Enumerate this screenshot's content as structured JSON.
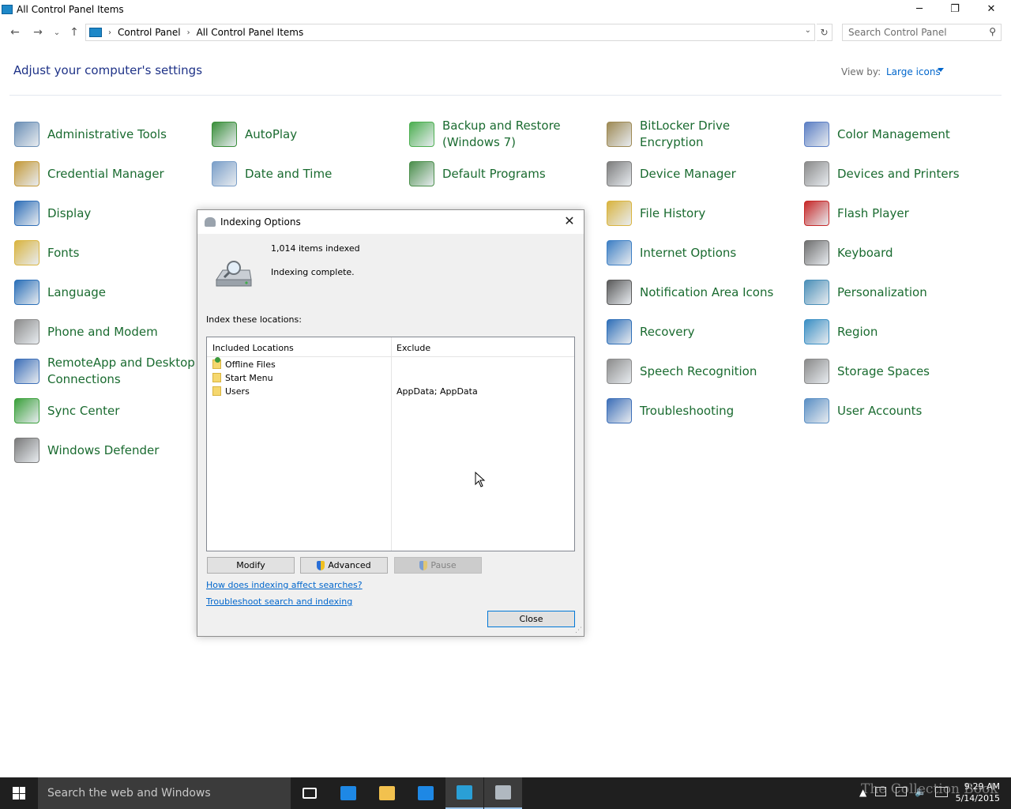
{
  "window": {
    "title": "All Control Panel Items",
    "minimize_glyph": "─",
    "restore_glyph": "❐",
    "close_glyph": "✕"
  },
  "nav": {
    "back_glyph": "←",
    "forward_glyph": "→",
    "recent_glyph": "⌄",
    "up_glyph": "↑",
    "breadcrumbs": [
      "Control Panel",
      "All Control Panel Items"
    ],
    "separator": "›",
    "dropdown_glyph": "⌄",
    "refresh_glyph": "↻",
    "search_placeholder": "Search Control Panel",
    "search_glyph": "⚲"
  },
  "header": {
    "title": "Adjust your computer's settings",
    "view_by_label": "View by:",
    "view_by_value": "Large icons"
  },
  "items": [
    {
      "label": "Administrative Tools",
      "icon": "admin-tools-icon",
      "color": "#6b8fb5"
    },
    {
      "label": "AutoPlay",
      "icon": "autoplay-icon",
      "color": "#3a8f3a"
    },
    {
      "label": "Backup and Restore (Windows 7)",
      "icon": "backup-icon",
      "color": "#4caf50"
    },
    {
      "label": "BitLocker Drive Encryption",
      "icon": "bitlocker-icon",
      "color": "#9e8a55"
    },
    {
      "label": "Color Management",
      "icon": "color-management-icon",
      "color": "#5c7fc4"
    },
    {
      "label": "Credential Manager",
      "icon": "credential-icon",
      "color": "#c49a3a"
    },
    {
      "label": "Date and Time",
      "icon": "clock-icon",
      "color": "#7a9ec8"
    },
    {
      "label": "Default Programs",
      "icon": "default-programs-icon",
      "color": "#4b8f4b"
    },
    {
      "label": "Device Manager",
      "icon": "device-manager-icon",
      "color": "#7d7d7d"
    },
    {
      "label": "Devices and Printers",
      "icon": "printer-icon",
      "color": "#8a8a8a"
    },
    {
      "label": "Display",
      "icon": "display-icon",
      "color": "#2f6fb8"
    },
    {
      "label": "File History",
      "icon": "file-history-icon",
      "color": "#d9b440"
    },
    {
      "label": "Flash Player",
      "icon": "flash-icon",
      "color": "#c62828"
    },
    {
      "label": "Fonts",
      "icon": "fonts-icon",
      "color": "#d9b440"
    },
    {
      "label": "Internet Options",
      "icon": "internet-icon",
      "color": "#3d7fc4"
    },
    {
      "label": "Keyboard",
      "icon": "keyboard-icon",
      "color": "#6f6f6f"
    },
    {
      "label": "Language",
      "icon": "language-icon",
      "color": "#2a6fb8"
    },
    {
      "label": "Notification Area Icons",
      "icon": "notification-icon",
      "color": "#5a5a5a"
    },
    {
      "label": "Personalization",
      "icon": "personalization-icon",
      "color": "#4a8fb8"
    },
    {
      "label": "Phone and Modem",
      "icon": "phone-icon",
      "color": "#8c8c8c"
    },
    {
      "label": "Recovery",
      "icon": "recovery-icon",
      "color": "#2f6fb8"
    },
    {
      "label": "Region",
      "icon": "region-icon",
      "color": "#3a8fc4"
    },
    {
      "label": "RemoteApp and Desktop Connections",
      "icon": "remoteapp-icon",
      "color": "#3d6fb8"
    },
    {
      "label": "Speech Recognition",
      "icon": "microphone-icon",
      "color": "#8c8c8c"
    },
    {
      "label": "Storage Spaces",
      "icon": "storage-icon",
      "color": "#8a8a8a"
    },
    {
      "label": "Sync Center",
      "icon": "sync-icon",
      "color": "#3aa03a"
    },
    {
      "label": "Troubleshooting",
      "icon": "troubleshooting-icon",
      "color": "#3d6fb8"
    },
    {
      "label": "User Accounts",
      "icon": "user-accounts-icon",
      "color": "#5a8fc4"
    },
    {
      "label": "Windows Defender",
      "icon": "defender-icon",
      "color": "#7a7a7a"
    }
  ],
  "dialog": {
    "title": "Indexing Options",
    "close_glyph": "✕",
    "items_indexed": "1,014 items indexed",
    "status": "Indexing complete.",
    "locations_label": "Index these locations:",
    "col_included": "Included Locations",
    "col_exclude": "Exclude",
    "rows": [
      {
        "name": "Offline Files",
        "exclude": "",
        "offline": true
      },
      {
        "name": "Start Menu",
        "exclude": "",
        "offline": false
      },
      {
        "name": "Users",
        "exclude": "AppData; AppData",
        "offline": false
      }
    ],
    "modify_label": "Modify",
    "advanced_label": "Advanced",
    "pause_label": "Pause",
    "link1": "How does indexing affect searches?",
    "link2": "Troubleshoot search and indexing",
    "close_label": "Close"
  },
  "taskbar": {
    "search_placeholder": "Search the web and Windows",
    "apps": [
      {
        "icon": "task-view-icon",
        "color": "#ffffff",
        "active": false
      },
      {
        "icon": "edge-icon",
        "color": "#1e88e5",
        "active": false
      },
      {
        "icon": "file-explorer-icon",
        "color": "#f2c14e",
        "active": false
      },
      {
        "icon": "store-icon",
        "color": "#1e88e5",
        "active": false
      },
      {
        "icon": "control-panel-icon",
        "color": "#2a9fd6",
        "active": true
      },
      {
        "icon": "indexing-options-icon",
        "color": "#b0b8c0",
        "active": true
      }
    ],
    "time": "9:29 AM",
    "date": "5/14/2015",
    "watermark": "The Collection Book"
  }
}
